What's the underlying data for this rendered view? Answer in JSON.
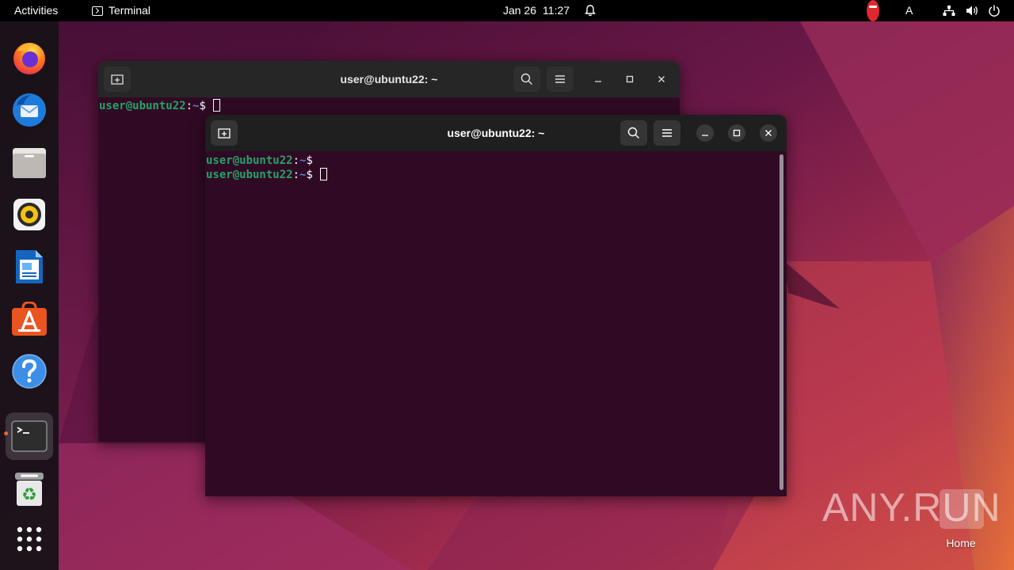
{
  "topbar": {
    "activities": "Activities",
    "app_name": "Terminal",
    "date": "Jan 26",
    "time": "11:27",
    "keyboard_layout": "A"
  },
  "dock": {
    "apps": [
      {
        "name": "Firefox",
        "icon": "firefox-icon"
      },
      {
        "name": "Thunderbird",
        "icon": "thunderbird-icon"
      },
      {
        "name": "Files",
        "icon": "files-icon"
      },
      {
        "name": "Rhythmbox",
        "icon": "rhythmbox-icon"
      },
      {
        "name": "LibreOffice Writer",
        "icon": "writer-icon"
      },
      {
        "name": "Ubuntu Software",
        "icon": "software-icon"
      },
      {
        "name": "Help",
        "icon": "help-icon"
      },
      {
        "name": "Terminal",
        "icon": "terminal-icon",
        "active": true
      },
      {
        "name": "Trash",
        "icon": "trash-icon"
      },
      {
        "name": "Show Applications",
        "icon": "app-grid-icon"
      }
    ]
  },
  "windows": {
    "back": {
      "title": "user@ubuntu22: ~",
      "lines": [
        {
          "user": "user@ubuntu22",
          "sep": ":",
          "path": "~",
          "prompt": "$",
          "cursor": true
        }
      ]
    },
    "front": {
      "title": "user@ubuntu22: ~",
      "lines": [
        {
          "user": "user@ubuntu22",
          "sep": ":",
          "path": "~",
          "prompt": "$",
          "cursor": false
        },
        {
          "user": "user@ubuntu22",
          "sep": ":",
          "path": "~",
          "prompt": "$",
          "cursor": true
        }
      ]
    }
  },
  "desktop": {
    "watermark": "ANY.RUN",
    "home_label": "Home"
  },
  "colors": {
    "terminal_bg": "#300a24",
    "prompt_user": "#26a269",
    "prompt_path": "#5a7fd6",
    "accent": "#e95420"
  }
}
